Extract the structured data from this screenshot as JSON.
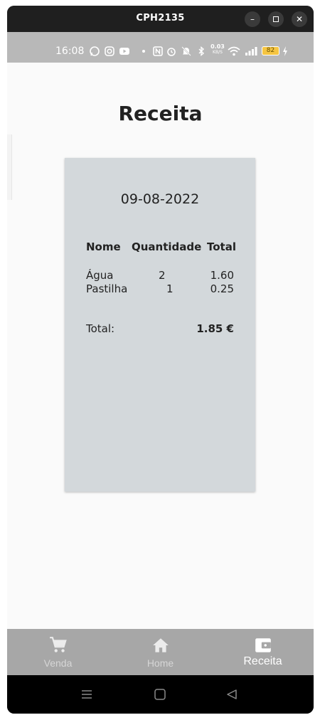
{
  "window": {
    "title": "CPH2135",
    "min_icon": "minimize-icon",
    "max_icon": "maximize-icon",
    "close_icon": "close-icon"
  },
  "status_bar": {
    "time": "16:08",
    "net_speed_value": "0.03",
    "net_speed_unit": "KB/S",
    "battery_level": "82",
    "icons": [
      "whatsapp-icon",
      "instagram-icon",
      "youtube-icon",
      "dot-icon",
      "nfc-icon",
      "alarm-icon",
      "mute-icon",
      "bluetooth-icon",
      "wifi-icon",
      "signal-icon",
      "battery-icon",
      "charging-icon"
    ]
  },
  "page": {
    "title": "Receita"
  },
  "receipt": {
    "date": "09-08-2022",
    "columns": [
      "Nome",
      "Quantidade",
      "Total"
    ],
    "rows": [
      {
        "name": "Água",
        "qty": "2",
        "total": "1.60"
      },
      {
        "name": "Pastilha",
        "qty": "1",
        "total": "0.25"
      }
    ],
    "total_label": "Total:",
    "total_value": "1.85 €"
  },
  "bottom_nav": {
    "items": [
      {
        "label": "Venda",
        "icon": "cart-icon",
        "active": false
      },
      {
        "label": "Home",
        "icon": "home-icon",
        "active": false
      },
      {
        "label": "Receita",
        "icon": "wallet-icon",
        "active": true
      }
    ]
  },
  "system_nav": {
    "icons": [
      "menu-icon",
      "home-square-icon",
      "back-triangle-icon"
    ]
  },
  "colors": {
    "receipt_bg": "#d3d8db",
    "nav_bg": "#a7a7a7",
    "status_bg": "#b8b8b8",
    "battery_badge": "#f5c542"
  }
}
